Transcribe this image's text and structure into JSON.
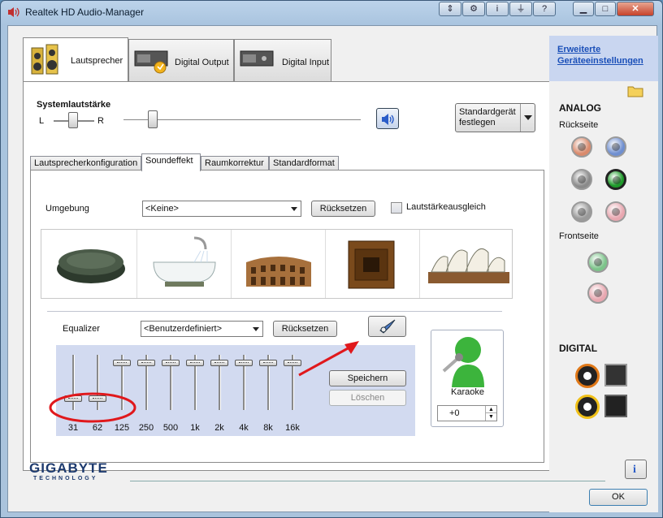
{
  "window": {
    "title": "Realtek HD Audio-Manager"
  },
  "main_tabs": [
    {
      "label": "Lautsprecher"
    },
    {
      "label": "Digital Output"
    },
    {
      "label": "Digital Input"
    }
  ],
  "volume": {
    "label": "Systemlautstärke",
    "balance_left": "L",
    "balance_right": "R",
    "default_device_button": "Standardgerät festlegen"
  },
  "sub_tabs": [
    {
      "label": "Lautsprecherkonfiguration"
    },
    {
      "label": "Soundeffekt"
    },
    {
      "label": "Raumkorrektur"
    },
    {
      "label": "Standardformat"
    }
  ],
  "environment": {
    "label": "Umgebung",
    "selected": "<Keine>",
    "reset_label": "Rücksetzen",
    "loudness_label": "Lautstärkeausgleich",
    "presets": [
      "stone",
      "bathtub",
      "colosseum",
      "wooden-box",
      "opera-house"
    ]
  },
  "equalizer": {
    "label": "Equalizer",
    "selected": "<Benutzerdefiniert>",
    "reset_label": "Rücksetzen",
    "save_label": "Speichern",
    "delete_label": "Löschen",
    "bands": [
      {
        "label": "31",
        "level": 0.2
      },
      {
        "label": "62",
        "level": 0.2
      },
      {
        "label": "125",
        "level": 0.85
      },
      {
        "label": "250",
        "level": 0.85
      },
      {
        "label": "500",
        "level": 0.85
      },
      {
        "label": "1k",
        "level": 0.85
      },
      {
        "label": "2k",
        "level": 0.85
      },
      {
        "label": "4k",
        "level": 0.85
      },
      {
        "label": "8k",
        "level": 0.85
      },
      {
        "label": "16k",
        "level": 0.85
      }
    ]
  },
  "karaoke": {
    "label": "Karaoke",
    "value": "+0"
  },
  "right_panel": {
    "advanced_link": "Erweiterte Geräteeinstellungen",
    "analog_title": "ANALOG",
    "rear_label": "Rückseite",
    "front_label": "Frontseite",
    "digital_title": "DIGITAL",
    "rear_jacks": [
      "#d98a6c",
      "#6f8fd0",
      "#8a8a8a",
      "#1e9a2a",
      "#9a9a9a",
      "#e8a7b0"
    ],
    "front_jacks": [
      "#7cc48a",
      "#e8a7b0"
    ],
    "colors": {
      "link": "#1a4fb8",
      "accent_red": "#e0181c"
    }
  },
  "footer": {
    "brand": "GIGABYTE",
    "brand_sub": "TECHNOLOGY",
    "ok_label": "OK"
  }
}
